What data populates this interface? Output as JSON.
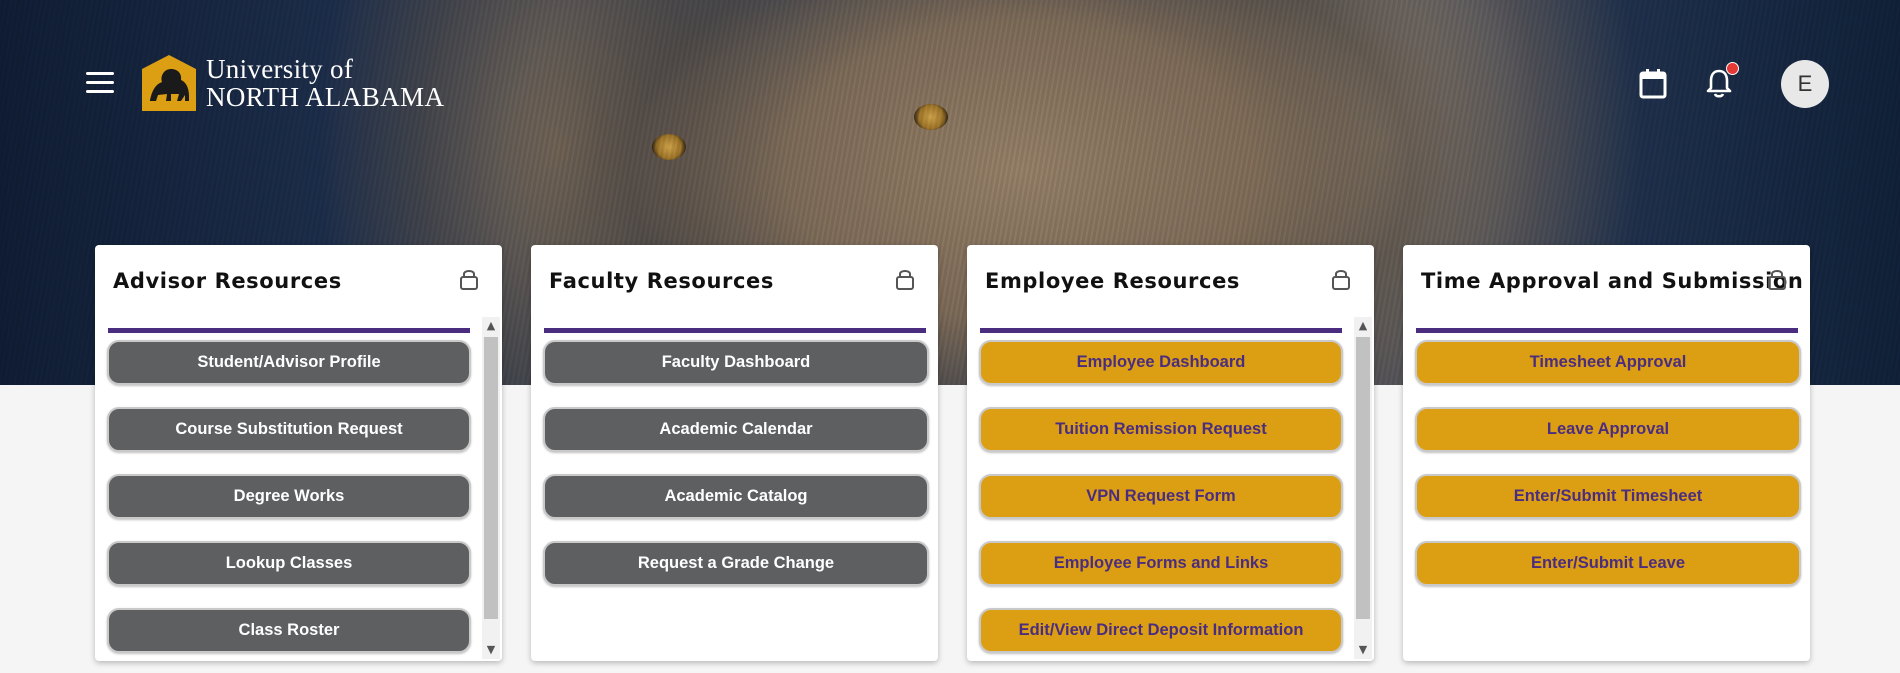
{
  "header": {
    "logo_line1": "University of",
    "logo_line2": "NORTH ALABAMA",
    "avatar_initial": "E",
    "icons": [
      "menu-icon",
      "calendar-icon",
      "bell-icon"
    ],
    "has_notification": true
  },
  "colors": {
    "purple": "#4b2d7f",
    "gold": "#dc9f13",
    "gray_button": "#5e5f61"
  },
  "cards": [
    {
      "title": "Advisor Resources",
      "button_style": "gray",
      "scrollbar": true,
      "buttons": [
        "Student/Advisor Profile",
        "Course Substitution Request",
        "Degree Works",
        "Lookup Classes",
        "Class Roster"
      ]
    },
    {
      "title": "Faculty Resources",
      "button_style": "gray",
      "scrollbar": false,
      "buttons": [
        "Faculty Dashboard",
        "Academic Calendar",
        "Academic Catalog",
        "Request a Grade Change"
      ]
    },
    {
      "title": "Employee Resources",
      "button_style": "gold",
      "scrollbar": true,
      "buttons": [
        "Employee Dashboard",
        "Tuition Remission Request",
        "VPN Request Form",
        "Employee Forms and Links",
        "Edit/View Direct Deposit Information"
      ]
    },
    {
      "title": "Time Approval and Submission",
      "button_style": "gold",
      "scrollbar": false,
      "buttons": [
        "Timesheet Approval",
        "Leave Approval",
        "Enter/Submit Timesheet",
        "Enter/Submit Leave"
      ]
    }
  ]
}
